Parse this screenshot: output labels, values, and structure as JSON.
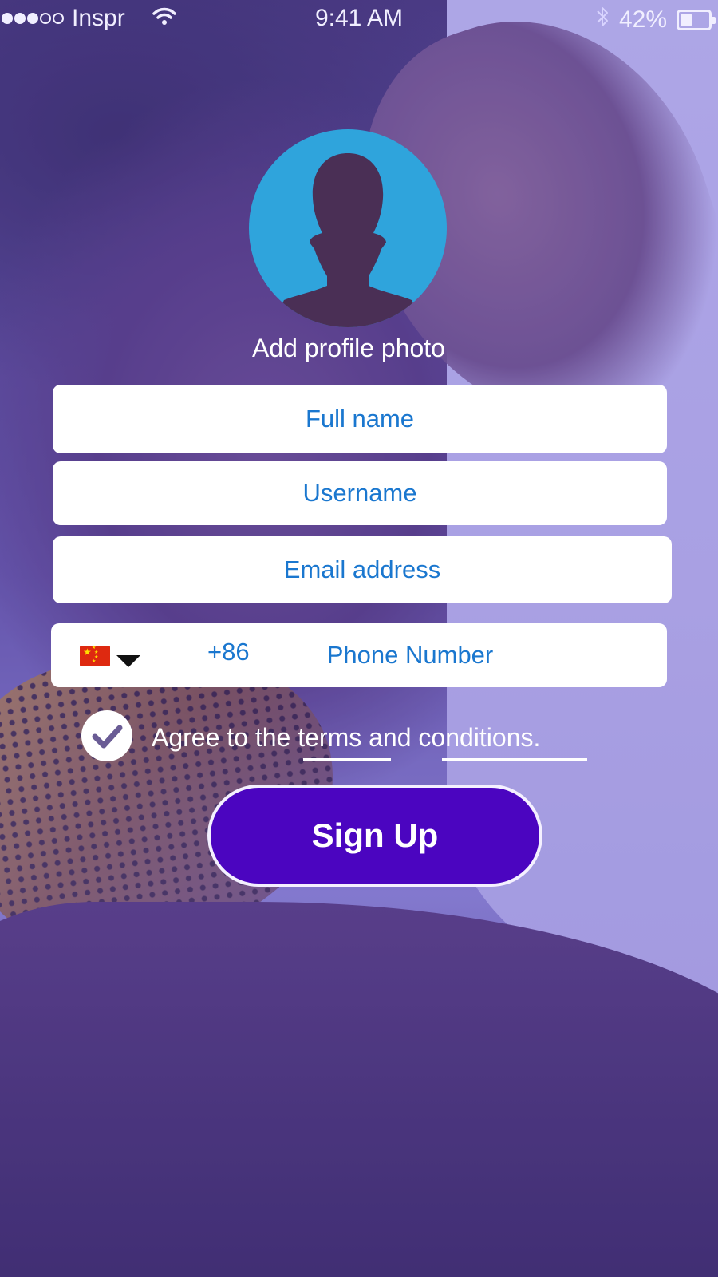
{
  "status_bar": {
    "carrier": "Inspr",
    "time": "9:41 AM",
    "battery_percent_label": "42%",
    "battery_level": 0.42,
    "signal_bars_filled": 3,
    "signal_bars_total": 5,
    "icons": [
      "wifi-icon",
      "bluetooth-icon",
      "battery-icon"
    ]
  },
  "profile": {
    "add_photo_label": "Add profile photo",
    "avatar_icon": "person-silhouette-icon",
    "avatar_color": "#2fa4dc"
  },
  "form": {
    "full_name_placeholder": "Full name",
    "full_name_value": "",
    "username_placeholder": "Username",
    "username_value": "",
    "email_placeholder": "Email address",
    "email_value": "",
    "phone": {
      "country_flag": "china-flag-icon",
      "dial_code": "+86",
      "placeholder": "Phone Number",
      "value": ""
    }
  },
  "terms": {
    "checked": true,
    "prefix": "Agree to the ",
    "terms_link": "terms",
    "middle": " and ",
    "conditions_link": "conditions."
  },
  "actions": {
    "sign_up_label": "Sign Up"
  },
  "colors": {
    "input_text": "#1a77cf",
    "signup_background": "#4b05c0",
    "overlay_tint": "#b9b3ea"
  }
}
